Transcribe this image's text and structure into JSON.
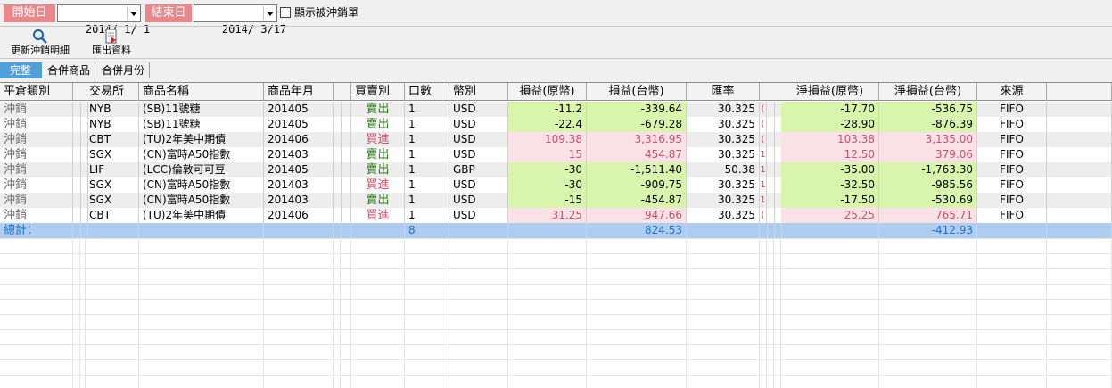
{
  "filters": {
    "start_label": "開始日",
    "start_date": "2014/ 1/ 1",
    "end_label": "結束日",
    "end_date": "2014/ 3/17",
    "show_cancelled_label": "顯示被沖銷單",
    "show_cancelled": false
  },
  "toolbar": {
    "refresh_label": "更新沖銷明細",
    "export_label": "匯出資料"
  },
  "tabs": [
    {
      "label": "完整",
      "active": true
    },
    {
      "label": "合併商品",
      "active": false
    },
    {
      "label": "合併月份",
      "active": false
    }
  ],
  "colors": {
    "date_label_bg": "#e8888d",
    "tab_active_bg": "#4f9fd9",
    "profit_bg": "#d9f4ad",
    "loss_bg": "#f9e1e6",
    "profit_text": "#2a7a1a",
    "loss_text": "#c8506a",
    "total_row_bg": "#aecdf0",
    "total_text": "#1a6fd0"
  },
  "table": {
    "columns": [
      "平倉類別",
      "交易所",
      "商品名稱",
      "商品年月",
      "買賣別",
      "口數",
      "幣別",
      "損益(原幣)",
      "損益(台幣)",
      "匯率",
      "淨損益(原幣)",
      "淨損益(台幣)",
      "來源"
    ],
    "rows": [
      {
        "type": "沖銷",
        "exchange": "NYB",
        "product": "(SB)11號糖",
        "month": "201405",
        "side": "賣出",
        "side_kind": "sell",
        "qty": "1",
        "currency": "USD",
        "pl_orig": "-11.2",
        "pl_twd": "-339.64",
        "rate": "30.325",
        "extra": "(",
        "net_orig": "-17.70",
        "net_twd": "-536.75",
        "source": "FIFO",
        "kind": "profit"
      },
      {
        "type": "沖銷",
        "exchange": "NYB",
        "product": "(SB)11號糖",
        "month": "201405",
        "side": "賣出",
        "side_kind": "sell",
        "qty": "1",
        "currency": "USD",
        "pl_orig": "-22.4",
        "pl_twd": "-679.28",
        "rate": "30.325",
        "extra": "(",
        "net_orig": "-28.90",
        "net_twd": "-876.39",
        "source": "FIFO",
        "kind": "profit"
      },
      {
        "type": "沖銷",
        "exchange": "CBT",
        "product": "(TU)2年美中期債",
        "month": "201406",
        "side": "買進",
        "side_kind": "buy",
        "qty": "1",
        "currency": "USD",
        "pl_orig": "109.38",
        "pl_twd": "3,316.95",
        "rate": "30.325",
        "extra": "(",
        "net_orig": "103.38",
        "net_twd": "3,135.00",
        "source": "FIFO",
        "kind": "loss"
      },
      {
        "type": "沖銷",
        "exchange": "SGX",
        "product": "(CN)富時A50指數",
        "month": "201403",
        "side": "賣出",
        "side_kind": "sell",
        "qty": "1",
        "currency": "USD",
        "pl_orig": "15",
        "pl_twd": "454.87",
        "rate": "30.325",
        "extra": "1",
        "net_orig": "12.50",
        "net_twd": "379.06",
        "source": "FIFO",
        "kind": "loss"
      },
      {
        "type": "沖銷",
        "exchange": "LIF",
        "product": "(LCC)倫敦可可豆",
        "month": "201405",
        "side": "賣出",
        "side_kind": "sell",
        "qty": "1",
        "currency": "GBP",
        "pl_orig": "-30",
        "pl_twd": "-1,511.40",
        "rate": "50.38",
        "extra": "1",
        "net_orig": "-35.00",
        "net_twd": "-1,763.30",
        "source": "FIFO",
        "kind": "profit"
      },
      {
        "type": "沖銷",
        "exchange": "SGX",
        "product": "(CN)富時A50指數",
        "month": "201403",
        "side": "買進",
        "side_kind": "buy",
        "qty": "1",
        "currency": "USD",
        "pl_orig": "-30",
        "pl_twd": "-909.75",
        "rate": "30.325",
        "extra": "1",
        "net_orig": "-32.50",
        "net_twd": "-985.56",
        "source": "FIFO",
        "kind": "profit"
      },
      {
        "type": "沖銷",
        "exchange": "SGX",
        "product": "(CN)富時A50指數",
        "month": "201403",
        "side": "賣出",
        "side_kind": "sell",
        "qty": "1",
        "currency": "USD",
        "pl_orig": "-15",
        "pl_twd": "-454.87",
        "rate": "30.325",
        "extra": "1",
        "net_orig": "-17.50",
        "net_twd": "-530.69",
        "source": "FIFO",
        "kind": "profit"
      },
      {
        "type": "沖銷",
        "exchange": "CBT",
        "product": "(TU)2年美中期債",
        "month": "201406",
        "side": "買進",
        "side_kind": "buy",
        "qty": "1",
        "currency": "USD",
        "pl_orig": "31.25",
        "pl_twd": "947.66",
        "rate": "30.325",
        "extra": "(",
        "net_orig": "25.25",
        "net_twd": "765.71",
        "source": "FIFO",
        "kind": "loss"
      }
    ],
    "total": {
      "label": "總計：",
      "qty": "8",
      "pl_twd": "824.53",
      "net_twd": "-412.93"
    }
  }
}
